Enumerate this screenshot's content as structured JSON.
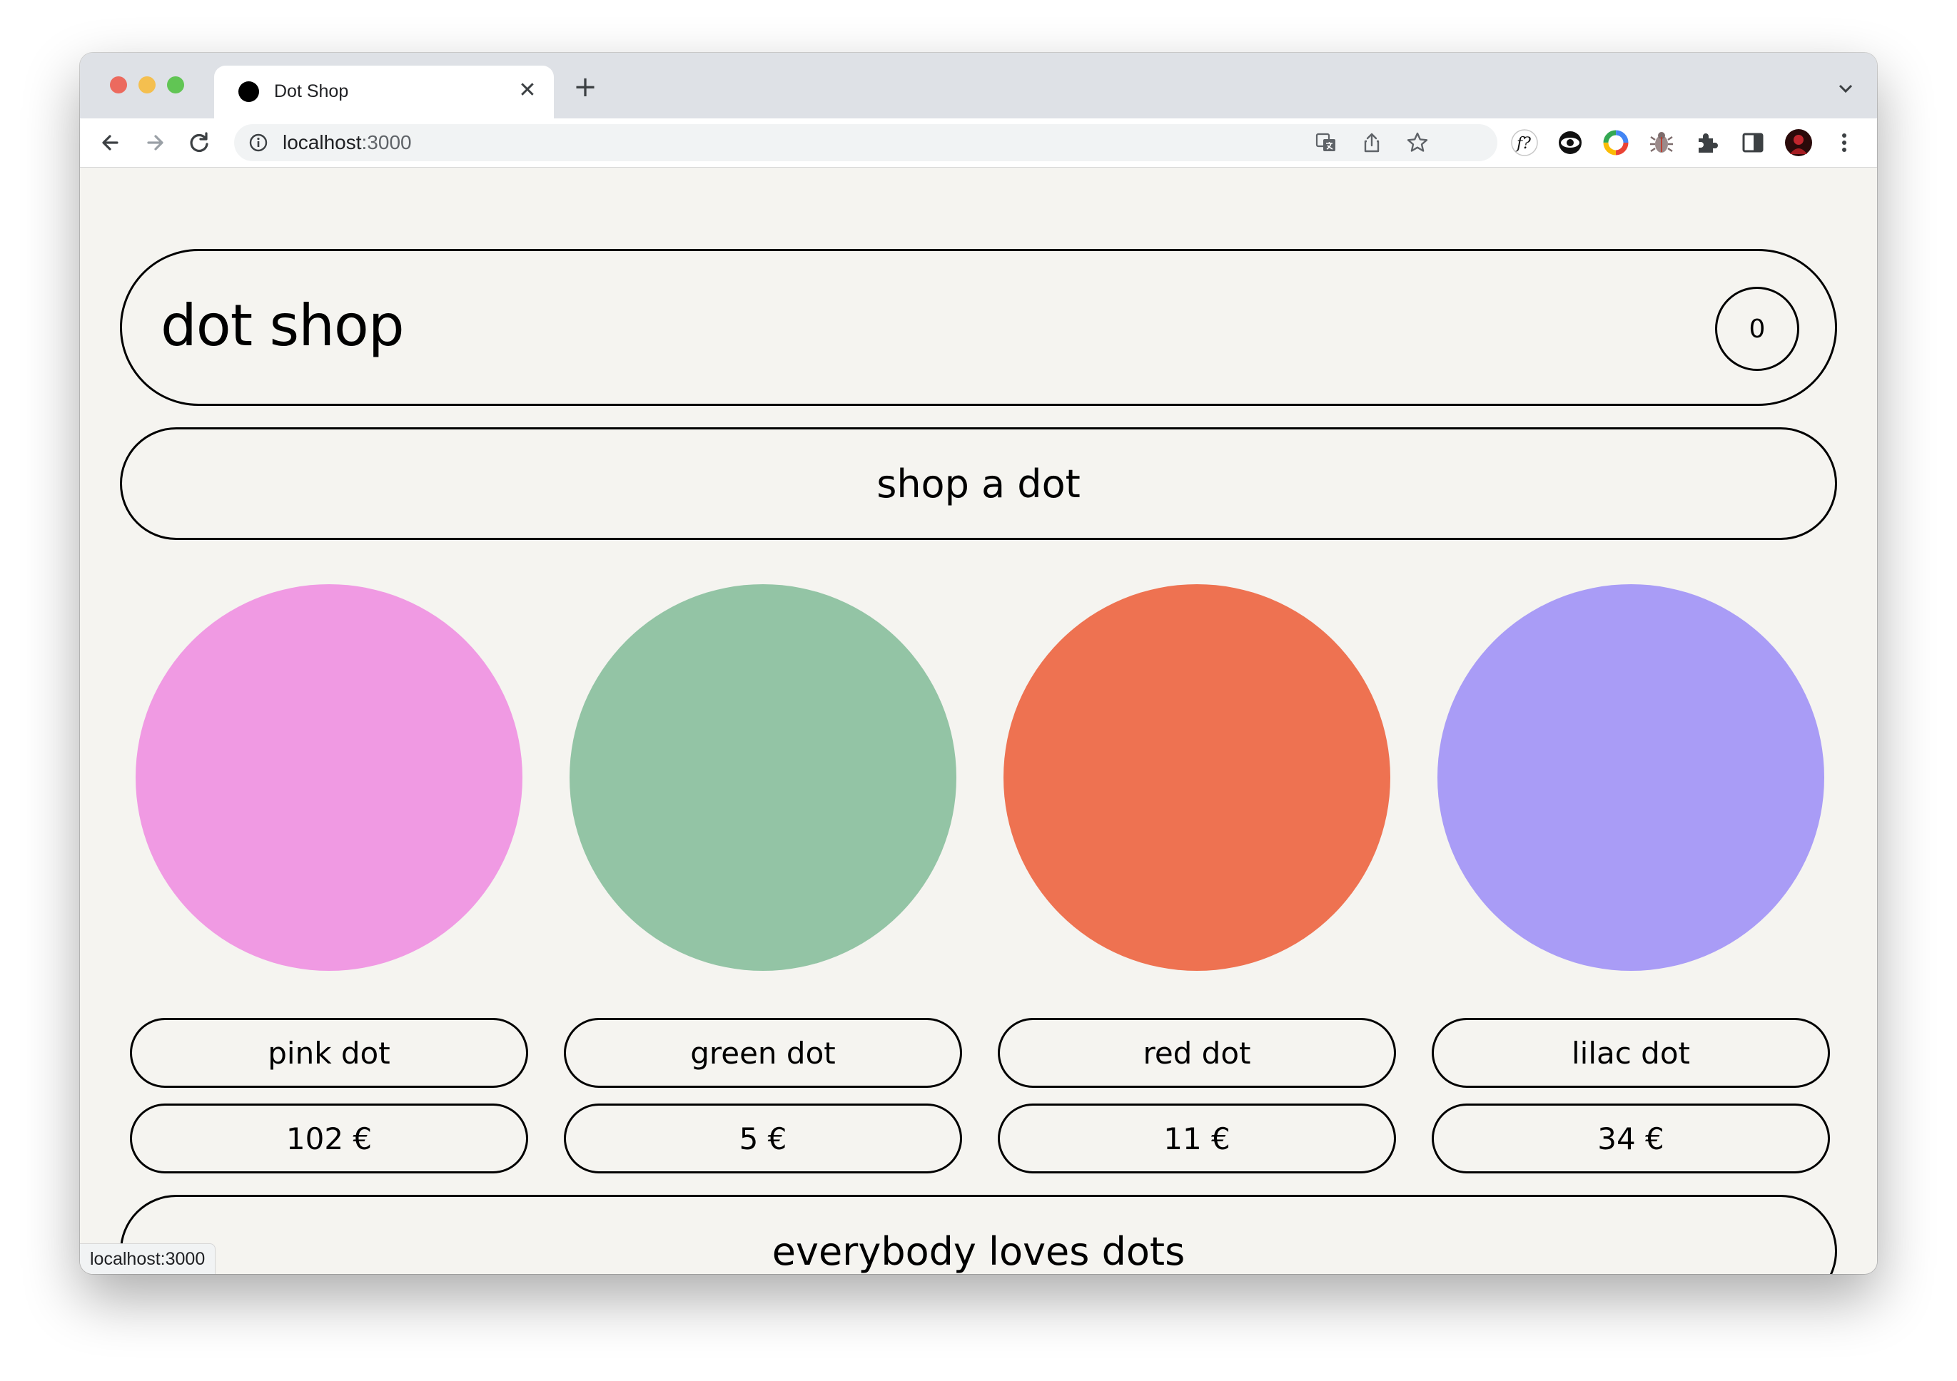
{
  "browser": {
    "tab": {
      "title": "Dot Shop",
      "close_glyph": "✕"
    },
    "new_tab_glyph": "+",
    "address": {
      "host": "localhost",
      "port": ":3000"
    },
    "status_url": "localhost:3000"
  },
  "header": {
    "brand": "dot shop",
    "cart_count": "0"
  },
  "shop_bar": {
    "label": "shop a dot"
  },
  "products": [
    {
      "name": "pink dot",
      "price": "102 €",
      "color": "#f09ae3"
    },
    {
      "name": "green dot",
      "price": "5 €",
      "color": "#93c4a5"
    },
    {
      "name": "red dot",
      "price": "11 €",
      "color": "#ee7251"
    },
    {
      "name": "lilac dot",
      "price": "34 €",
      "color": "#a99cf6"
    }
  ],
  "footer": {
    "label": "everybody loves dots"
  }
}
